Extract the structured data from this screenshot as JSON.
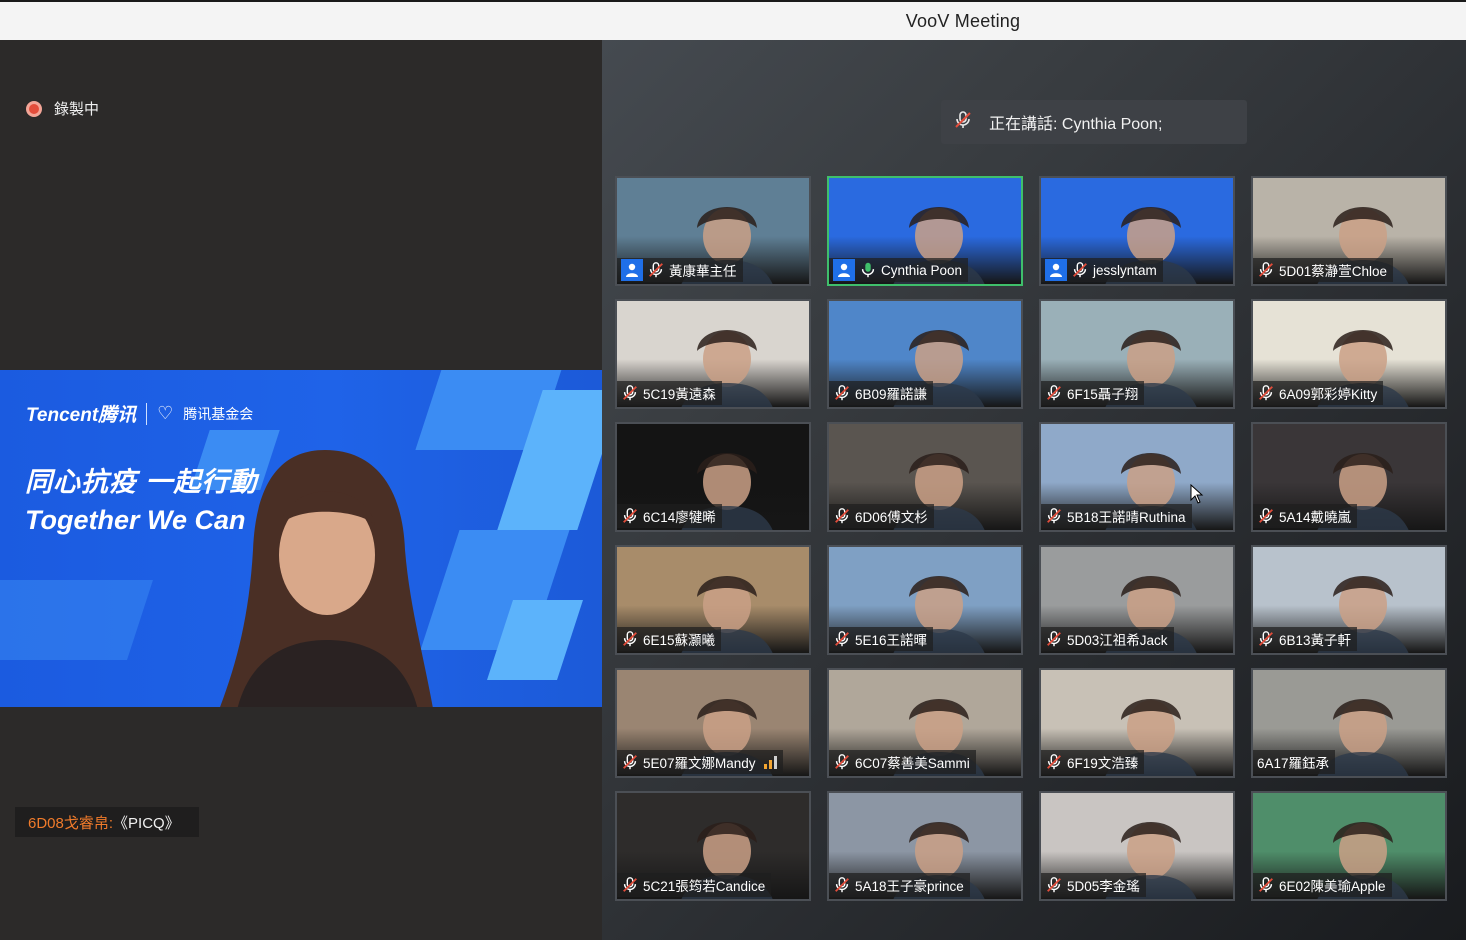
{
  "window": {
    "title": "VooV Meeting"
  },
  "recording": {
    "label": "錄製中"
  },
  "main_video": {
    "logo_brand": "Tencent腾讯",
    "logo_foundation": "腾讯基金会",
    "slogan_zh": "同心抗疫 一起行動",
    "slogan_en": "Together We Can"
  },
  "chat": {
    "sender": "6D08戈睿帛:",
    "message": "《PICQ》"
  },
  "speaking_banner": {
    "text": "正在講話: Cynthia Poon;"
  },
  "colors": {
    "accent_green": "#3fbf6b",
    "record_red": "#e34d3b",
    "chat_sender": "#f07b2b",
    "user_badge_blue": "#1f6fe8"
  },
  "participants": [
    {
      "name": "黃康華主任",
      "mic": "muted",
      "badge": true,
      "bg": "#5f7f95"
    },
    {
      "name": "Cynthia Poon",
      "mic": "on",
      "badge": true,
      "active": true,
      "bg": "#2a6ae0"
    },
    {
      "name": "jesslyntam",
      "mic": "muted",
      "badge": true,
      "bg": "#2a6ae0"
    },
    {
      "name": "5D01蔡瀞萱Chloe",
      "mic": "muted",
      "bg": "#b9b3a8"
    },
    {
      "name": "5C19黃遠森",
      "mic": "muted",
      "bg": "#d9d5cf"
    },
    {
      "name": "6B09羅諾謙",
      "mic": "muted",
      "bg": "#4f86c9"
    },
    {
      "name": "6F15聶子翔",
      "mic": "muted",
      "bg": "#9ab0b8"
    },
    {
      "name": "6A09郭彩婷Kitty",
      "mic": "muted",
      "bg": "#e6e2d6"
    },
    {
      "name": "6C14廖犍晞",
      "mic": "muted",
      "bg": "#141414"
    },
    {
      "name": "6D06傅文杉",
      "mic": "muted",
      "bg": "#5a5550"
    },
    {
      "name": "5B18王諾晴Ruthina",
      "mic": "muted",
      "bg": "#8fa9c9"
    },
    {
      "name": "5A14戴曉嵐",
      "mic": "muted",
      "bg": "#3a3638"
    },
    {
      "name": "6E15蘇灝曦",
      "mic": "muted",
      "bg": "#a88c6a"
    },
    {
      "name": "5E16王諾暉",
      "mic": "muted",
      "bg": "#7fa0c4"
    },
    {
      "name": "5D03江祖希Jack",
      "mic": "muted",
      "bg": "#9a9c9d"
    },
    {
      "name": "6B13黃子軒",
      "mic": "muted",
      "bg": "#b8c2cc"
    },
    {
      "name": "5E07羅文娜Mandy",
      "mic": "muted",
      "signal": true,
      "bg": "#9a8572"
    },
    {
      "name": "6C07蔡善美Sammi",
      "mic": "muted",
      "bg": "#b0a79a"
    },
    {
      "name": "6F19文浩臻",
      "mic": "muted",
      "bg": "#c8c1b6"
    },
    {
      "name": "6A17羅鈺承",
      "mic": "none",
      "bg": "#9a9a95"
    },
    {
      "name": "5C21張筠若Candice",
      "mic": "muted",
      "bg": "#2e2c2b"
    },
    {
      "name": "5A18王子豪prince",
      "mic": "muted",
      "bg": "#8c96a4"
    },
    {
      "name": "5D05李金瑤",
      "mic": "muted",
      "bg": "#c9c5c2"
    },
    {
      "name": "6E02陳美瑜Apple",
      "mic": "muted",
      "bg": "#4f8e6a"
    }
  ]
}
